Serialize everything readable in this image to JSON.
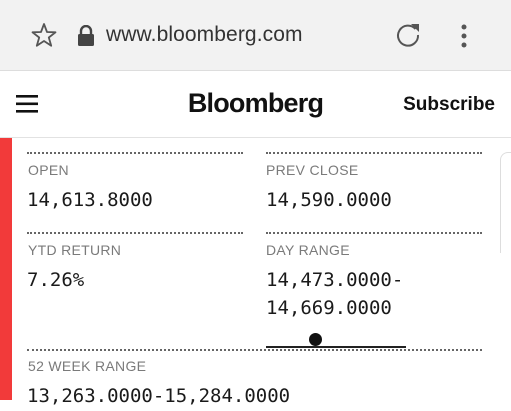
{
  "browser": {
    "url": "www.bloomberg.com",
    "icons": [
      "star-icon",
      "lock-icon",
      "reload-icon",
      "more-vertical-icon"
    ]
  },
  "header": {
    "logo": "Bloomberg",
    "subscribe_label": "Subscribe",
    "menu_icon": "hamburger-menu-icon"
  },
  "stats": {
    "open_label": "OPEN",
    "open_value": "14,613.8000",
    "prev_close_label": "PREV CLOSE",
    "prev_close_value": "14,590.0000",
    "ytd_return_label": "YTD RETURN",
    "ytd_return_value": "7.26%",
    "day_range_label": "DAY RANGE",
    "day_range_low": "14,473.0000-",
    "day_range_high": "14,669.0000",
    "week52_label": "52 WEEK RANGE",
    "week52_value": "13,263.0000-15,284.0000"
  },
  "colors": {
    "accent_red": "#f23a3a",
    "browser_bar": "#f2f2f2"
  }
}
